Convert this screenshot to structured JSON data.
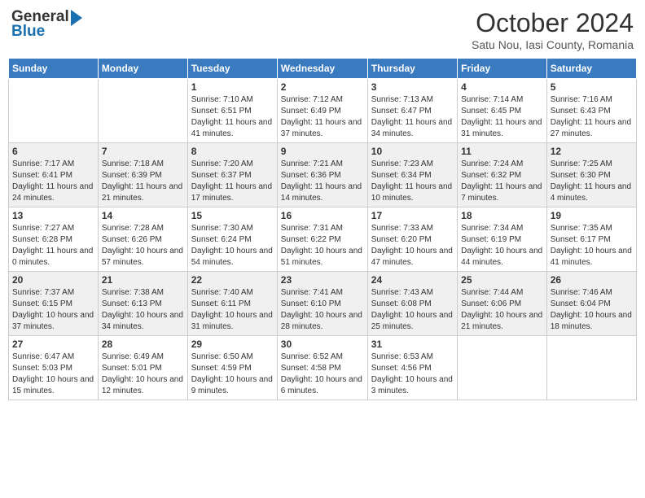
{
  "header": {
    "logo_general": "General",
    "logo_blue": "Blue",
    "month_title": "October 2024",
    "location": "Satu Nou, Iasi County, Romania"
  },
  "days_of_week": [
    "Sunday",
    "Monday",
    "Tuesday",
    "Wednesday",
    "Thursday",
    "Friday",
    "Saturday"
  ],
  "weeks": [
    [
      {
        "day": "",
        "info": ""
      },
      {
        "day": "",
        "info": ""
      },
      {
        "day": "1",
        "info": "Sunrise: 7:10 AM\nSunset: 6:51 PM\nDaylight: 11 hours and 41 minutes."
      },
      {
        "day": "2",
        "info": "Sunrise: 7:12 AM\nSunset: 6:49 PM\nDaylight: 11 hours and 37 minutes."
      },
      {
        "day": "3",
        "info": "Sunrise: 7:13 AM\nSunset: 6:47 PM\nDaylight: 11 hours and 34 minutes."
      },
      {
        "day": "4",
        "info": "Sunrise: 7:14 AM\nSunset: 6:45 PM\nDaylight: 11 hours and 31 minutes."
      },
      {
        "day": "5",
        "info": "Sunrise: 7:16 AM\nSunset: 6:43 PM\nDaylight: 11 hours and 27 minutes."
      }
    ],
    [
      {
        "day": "6",
        "info": "Sunrise: 7:17 AM\nSunset: 6:41 PM\nDaylight: 11 hours and 24 minutes."
      },
      {
        "day": "7",
        "info": "Sunrise: 7:18 AM\nSunset: 6:39 PM\nDaylight: 11 hours and 21 minutes."
      },
      {
        "day": "8",
        "info": "Sunrise: 7:20 AM\nSunset: 6:37 PM\nDaylight: 11 hours and 17 minutes."
      },
      {
        "day": "9",
        "info": "Sunrise: 7:21 AM\nSunset: 6:36 PM\nDaylight: 11 hours and 14 minutes."
      },
      {
        "day": "10",
        "info": "Sunrise: 7:23 AM\nSunset: 6:34 PM\nDaylight: 11 hours and 10 minutes."
      },
      {
        "day": "11",
        "info": "Sunrise: 7:24 AM\nSunset: 6:32 PM\nDaylight: 11 hours and 7 minutes."
      },
      {
        "day": "12",
        "info": "Sunrise: 7:25 AM\nSunset: 6:30 PM\nDaylight: 11 hours and 4 minutes."
      }
    ],
    [
      {
        "day": "13",
        "info": "Sunrise: 7:27 AM\nSunset: 6:28 PM\nDaylight: 11 hours and 0 minutes."
      },
      {
        "day": "14",
        "info": "Sunrise: 7:28 AM\nSunset: 6:26 PM\nDaylight: 10 hours and 57 minutes."
      },
      {
        "day": "15",
        "info": "Sunrise: 7:30 AM\nSunset: 6:24 PM\nDaylight: 10 hours and 54 minutes."
      },
      {
        "day": "16",
        "info": "Sunrise: 7:31 AM\nSunset: 6:22 PM\nDaylight: 10 hours and 51 minutes."
      },
      {
        "day": "17",
        "info": "Sunrise: 7:33 AM\nSunset: 6:20 PM\nDaylight: 10 hours and 47 minutes."
      },
      {
        "day": "18",
        "info": "Sunrise: 7:34 AM\nSunset: 6:19 PM\nDaylight: 10 hours and 44 minutes."
      },
      {
        "day": "19",
        "info": "Sunrise: 7:35 AM\nSunset: 6:17 PM\nDaylight: 10 hours and 41 minutes."
      }
    ],
    [
      {
        "day": "20",
        "info": "Sunrise: 7:37 AM\nSunset: 6:15 PM\nDaylight: 10 hours and 37 minutes."
      },
      {
        "day": "21",
        "info": "Sunrise: 7:38 AM\nSunset: 6:13 PM\nDaylight: 10 hours and 34 minutes."
      },
      {
        "day": "22",
        "info": "Sunrise: 7:40 AM\nSunset: 6:11 PM\nDaylight: 10 hours and 31 minutes."
      },
      {
        "day": "23",
        "info": "Sunrise: 7:41 AM\nSunset: 6:10 PM\nDaylight: 10 hours and 28 minutes."
      },
      {
        "day": "24",
        "info": "Sunrise: 7:43 AM\nSunset: 6:08 PM\nDaylight: 10 hours and 25 minutes."
      },
      {
        "day": "25",
        "info": "Sunrise: 7:44 AM\nSunset: 6:06 PM\nDaylight: 10 hours and 21 minutes."
      },
      {
        "day": "26",
        "info": "Sunrise: 7:46 AM\nSunset: 6:04 PM\nDaylight: 10 hours and 18 minutes."
      }
    ],
    [
      {
        "day": "27",
        "info": "Sunrise: 6:47 AM\nSunset: 5:03 PM\nDaylight: 10 hours and 15 minutes."
      },
      {
        "day": "28",
        "info": "Sunrise: 6:49 AM\nSunset: 5:01 PM\nDaylight: 10 hours and 12 minutes."
      },
      {
        "day": "29",
        "info": "Sunrise: 6:50 AM\nSunset: 4:59 PM\nDaylight: 10 hours and 9 minutes."
      },
      {
        "day": "30",
        "info": "Sunrise: 6:52 AM\nSunset: 4:58 PM\nDaylight: 10 hours and 6 minutes."
      },
      {
        "day": "31",
        "info": "Sunrise: 6:53 AM\nSunset: 4:56 PM\nDaylight: 10 hours and 3 minutes."
      },
      {
        "day": "",
        "info": ""
      },
      {
        "day": "",
        "info": ""
      }
    ]
  ]
}
